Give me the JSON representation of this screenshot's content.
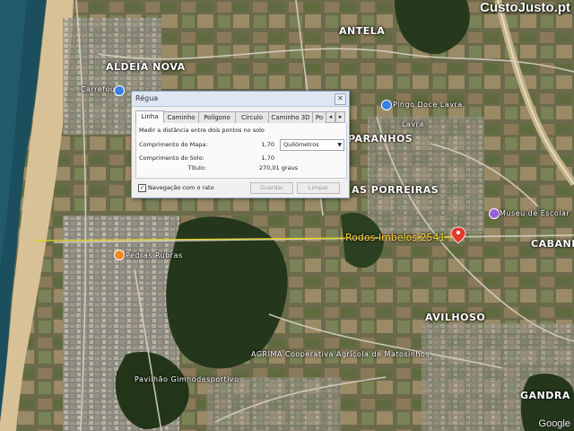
{
  "watermark": "CustoJusto.pt",
  "map_labels": {
    "antela": "ANTELA",
    "aldeia_nova": "ALDEIA NOVA",
    "carrefour": "Carrefour",
    "pingo_doce": "Pingo Doce Lavra",
    "paranhos": "PARANHOS",
    "lavra": "Lavra",
    "porreiras": "AS PORREIRAS",
    "museu": "Museu de Escolar",
    "cabanelas": "CABANEL",
    "pedras_rubras": "Pedras Rubras",
    "agrima": "AGRIMA Cooperativa Agrícola de Matosinhos",
    "avilhoso": "AVILHOSO",
    "pavilhao": "Pavilhão Gimnodesportivo",
    "gandra": "GANDRA",
    "google": "Google"
  },
  "ruler": {
    "label": "Rodos Imbelos 2541"
  },
  "colors": {
    "ruler_line": "#e8d21e",
    "pin": "#e33a2e",
    "poi_blue": "#3a7ee8",
    "poi_orange": "#f08a24",
    "poi_purple": "#9a5fe0"
  },
  "dialog": {
    "title": "Régua",
    "close_icon": "close-icon",
    "tabs": [
      "Linha",
      "Caminho",
      "Polígono",
      "Círculo",
      "Caminho 3D",
      "Po"
    ],
    "active_tab": "Linha",
    "description": "Medir a distância entre dois pontos no solo",
    "map_length_label": "Comprimento do Mapa:",
    "map_length_value": "1,70",
    "unit_selected": "Quilómetros",
    "ground_length_label": "Comprimento do Solo:",
    "ground_length_value": "1,70",
    "heading_label": "Título:",
    "heading_value": "270,01 graus",
    "mouse_nav_label": "Navegação com o rato",
    "mouse_nav_checked": true,
    "save_label": "Guardar",
    "clear_label": "Limpar"
  }
}
